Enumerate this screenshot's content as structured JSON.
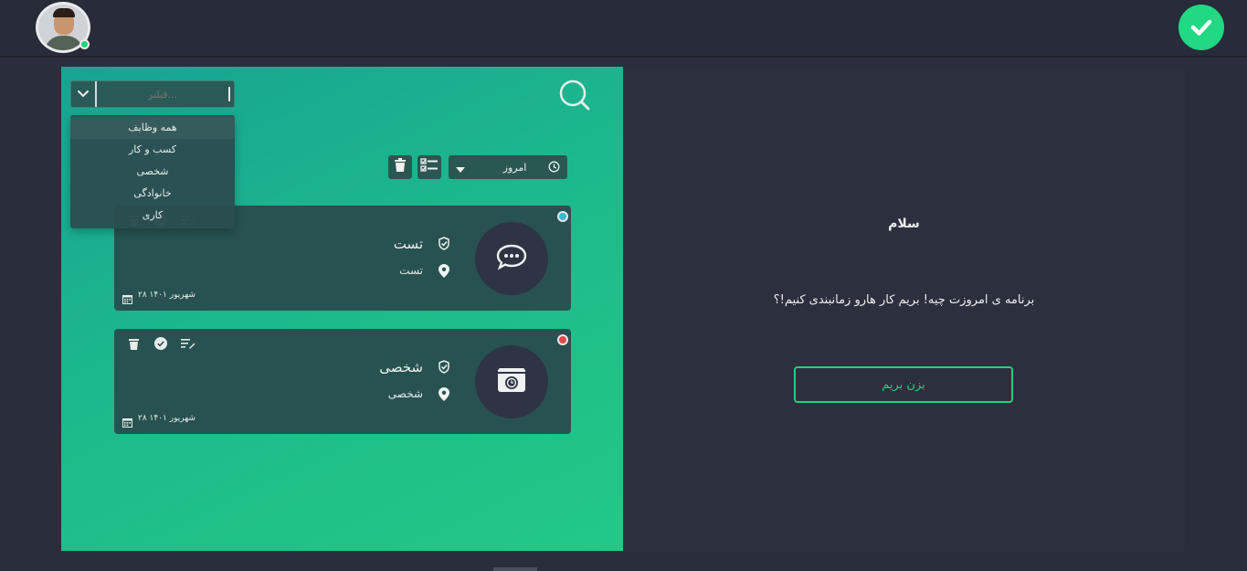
{
  "header": {
    "user": {
      "online": true
    },
    "check_badge": {
      "color": "#21d883"
    }
  },
  "tasks_panel": {
    "filter": {
      "placeholder": "فیلتر...",
      "options": [
        "همه وظایف",
        "کسب و کار",
        "شخصی",
        "خانوادگی",
        "کاری"
      ],
      "active_index": 0
    },
    "date_select": {
      "label": "امروز"
    },
    "tasks": [
      {
        "title": "تست",
        "category": "تست",
        "date": "۲۸ شهریور ۱۴۰۱",
        "status_color": "#3bb6d1",
        "icon": "chat-bubble-icon"
      },
      {
        "title": "شخصی",
        "category": "شخصی",
        "date": "۲۸ شهریور ۱۴۰۱",
        "status_color": "#e04a4a",
        "icon": "photo-album-icon"
      }
    ]
  },
  "welcome": {
    "greeting": "سلام",
    "message": "برنامه ی امروزت چیه! بریم کار هارو زمانبندی کنیم!؟",
    "cta": "بزن بریم"
  },
  "colors": {
    "accent": "#22d07f",
    "panel_dark": "#2c2f3e",
    "card": "#285251"
  }
}
